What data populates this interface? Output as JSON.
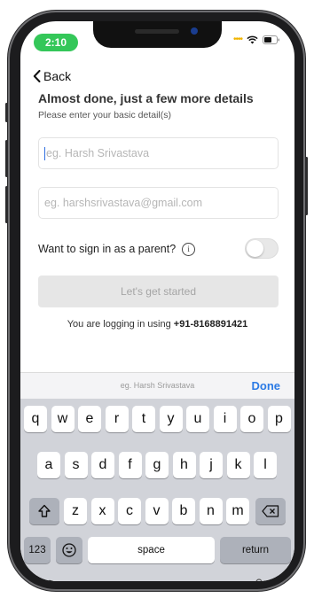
{
  "status": {
    "time": "2:10"
  },
  "nav": {
    "back_label": "Back"
  },
  "header": {
    "title": "Almost done, just a few more details",
    "subtitle": "Please enter your basic detail(s)"
  },
  "form": {
    "name_placeholder": "eg. Harsh Srivastava",
    "email_placeholder": "eg. harshsrivastava@gmail.com",
    "parent_label": "Want to sign in as a parent?",
    "parent_toggle_on": false,
    "submit_label": "Let's get started",
    "login_prefix": "You are logging in using",
    "login_phone": "+91-8168891421"
  },
  "keyboard": {
    "accessory_placeholder": "eg. Harsh Srivastava",
    "done_label": "Done",
    "row1": [
      "q",
      "w",
      "e",
      "r",
      "t",
      "y",
      "u",
      "i",
      "o",
      "p"
    ],
    "row2": [
      "a",
      "s",
      "d",
      "f",
      "g",
      "h",
      "j",
      "k",
      "l"
    ],
    "row3": [
      "z",
      "x",
      "c",
      "v",
      "b",
      "n",
      "m"
    ],
    "numbers_label": "123",
    "space_label": "space",
    "return_label": "return"
  },
  "colors": {
    "accent": "#2c7be5",
    "status_pill": "#34c759"
  }
}
